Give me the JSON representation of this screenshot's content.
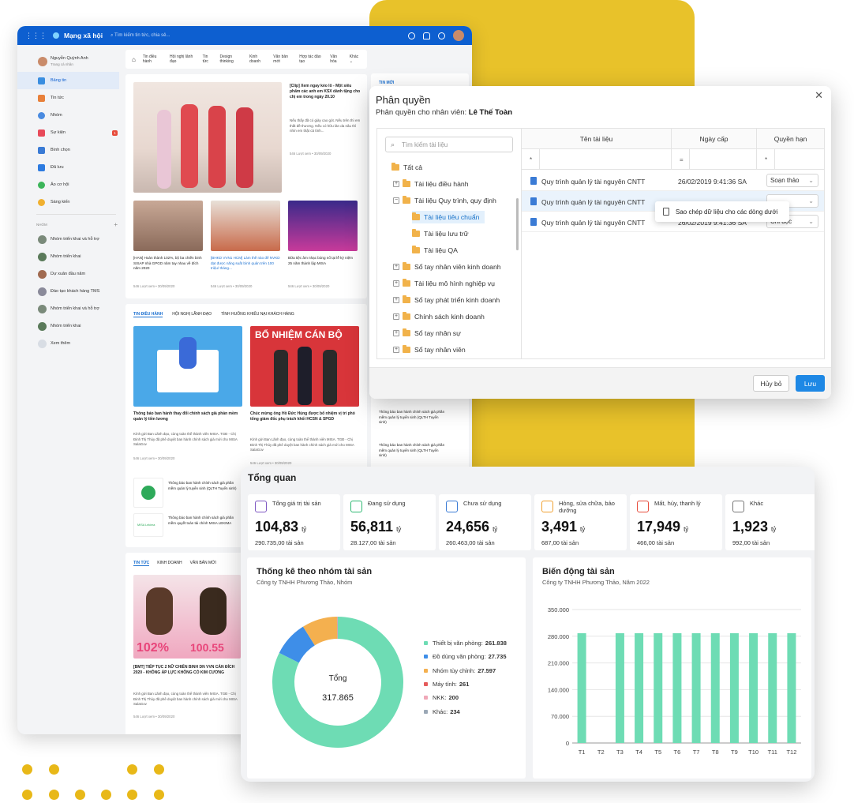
{
  "social": {
    "app_name": "Mạng xã hội",
    "search_placeholder": "Tìm kiếm tin tức, chia sẻ...",
    "user_name": "Nguyễn Quỳnh Anh",
    "user_sub": "Trang cá nhân",
    "menu": [
      "Bảng tin",
      "Tin tức",
      "Nhóm",
      "Sự kiện",
      "Bình chọn",
      "Đã lưu",
      "Ảo cơ hội",
      "Sáng kiến"
    ],
    "event_badge": "1",
    "groups_title": "NHÓM",
    "groups": [
      "Nhóm triển khai và hỗ trợ",
      "Nhóm triển khai",
      "Dự xuân đầu năm",
      "Đào tạo khách hàng TMS",
      "Nhóm triển khai và hỗ trợ",
      "Nhóm triển khai"
    ],
    "more": "Xem thêm",
    "tabs": [
      "Tin điều hành",
      "Hội nghị lãnh đạo",
      "Tin tức",
      "Design thinking",
      "Kinh doanh",
      "Văn bản mới",
      "Hợp tác đào tạo",
      "Văn hóa",
      "Khác"
    ],
    "featured_title": "[Clip] Xem ngay kéo lô - Một siêu phẩm các anh em KSX dành tặng cho chị em trong ngày 20.10",
    "featured_desc": "Nếu thấy đã có giày cao gót. Nếu trên thì em thất đề thương. Nếu có hữu làn da nâu thì nhìn em thật cả tình...",
    "featured_meta": "546 Lượt xem  •  30/09/2020",
    "small_posts": [
      {
        "title": "[HAN] Hoàn thành 102%, bộ ba chiến binh SISAP nhà GPGD năm tay nhau về đích năm 2020",
        "meta": "546 Lượt xem  •  30/09/2020"
      },
      {
        "title": "[BHKD VVN1 HCM] Làm thế nào để NVKD đạt được năng suất bình quân trên 100 triệu/ tháng...",
        "meta": "546 Lượt xem  •  30/09/2020"
      },
      {
        "title": "Bữa tiệc âm nhạc bùng nổ tại lễ kỷ niệm 25 năm thành lập MISA",
        "meta": "546 Lượt xem  •  30/09/2020"
      }
    ],
    "right_title": "TIN MỚI",
    "section2_tabs": [
      "TIN ĐIỀU HÀNH",
      "HỘI NGHỊ LÃNH ĐẠO",
      "TÌNH HUỐNG KHIẾU NẠI KHÁCH HÀNG"
    ],
    "board_banner": "BỔ NHIỆM CÁN BỘ",
    "post_a": {
      "title": "Thông báo ban hành thay đổi chính sách giá phần mềm quản lý tiền lương",
      "desc": "Kính gửi Ban Lãnh đạo, cùng toàn thể thành viên MISA. TGĐ - Chị Đinh Thị Thúy đã phê duyệt ban hành chính sách giá mới cho MISA SalaGov",
      "meta": "546 Lượt xem  •  30/09/2020"
    },
    "post_b": {
      "title": "Chúc mừng ông Hồ Đức Hùng được bổ nhiệm vị trí phó tổng giám đốc phụ trách khối HCSN & SPGD",
      "desc": "Kính gửi Ban Lãnh đạo, cùng toàn thể thành viên MISA. TGĐ - Chị Đinh Thị Thúy đã phê duyệt ban hành chính sách giá mới cho MISA SalaGov",
      "meta": "546 Lượt xem  •  30/09/2020"
    },
    "list_posts": [
      "Thông báo ban hành chính sách giá phần mềm quản lý tuyển sinh (QLTH Tuyển sinh)",
      "Thông báo ban hành chính sách giá phần mềm quyết toán tài chính MISA LEKIMA"
    ],
    "right_posts": [
      "Thông báo ban hành chính sách giá phần mềm quản lý tuyển sinh (QLTH Tuyển sinh)",
      "Thông báo ban hành chính sách giá phần mềm quản lý tuyển sinh (QLTH Tuyển sinh)"
    ],
    "logo_word": "MISA Lekima",
    "section3_tabs": [
      "TIN TỨC",
      "KINH DOANH",
      "VĂN BẢN MỚI"
    ],
    "promo_left": "102%",
    "promo_right": "100.55",
    "post_c": {
      "title": "[BMT] TIẾP TỤC 2 NỮ CHIẾN BINH DN VVN CÁN ĐÍCH 2020 - KHÔNG ÁP LỰC KHÔNG CÓ KIM CƯƠNG",
      "desc": "Kính gửi Ban Lãnh đạo, cùng toàn thể thành viên MISA. TGĐ - Chị Đinh Thị Thúy đã phê duyệt ban hành chính sách giá mới cho MISA SalaGov",
      "meta": "546 Lượt xem  •  30/09/2020"
    }
  },
  "dialog": {
    "title": "Phân quyền",
    "subtitle_prefix": "Phân quyền cho nhân viên:",
    "employee": "Lê Thế Toàn",
    "search_placeholder": "Tìm kiếm tài liệu",
    "tree": [
      "Tất cả",
      "Tài liệu điều hành",
      "Tài liệu Quy trình, quy định",
      "Tài liệu tiêu chuẩn",
      "Tài liệu lưu trữ",
      "Tài liệu QA",
      "Sổ tay nhân viên kinh doanh",
      "Tài liệu mô hình nghiệp vụ",
      "Sổ tay phát triển kinh doanh",
      "Chính sách kinh doanh",
      "Sổ tay nhân sự",
      "Sổ tay nhân viên"
    ],
    "columns": [
      "Tên tài liệu",
      "Ngày cấp",
      "Quyền hạn"
    ],
    "filters": [
      "*",
      "=",
      "*"
    ],
    "rows": [
      {
        "name": "Quy trình quản lý tài nguyên CNTT",
        "date": "26/02/2019 9:41:36 SA",
        "perm": "Soạn thảo"
      },
      {
        "name": "Quy trình quản lý tài nguyên CNTT",
        "date": "",
        "perm": ""
      },
      {
        "name": "Quy trình quản lý tài nguyên CNTT",
        "date": "26/02/2019 9:41:36 SA",
        "perm": "Chỉ đọc"
      }
    ],
    "context_menu": "Sao chép dữ liệu cho các dòng dưới",
    "cancel": "Hủy bỏ",
    "save": "Lưu"
  },
  "dashboard": {
    "title": "Tổng quan",
    "kpis": [
      {
        "label": "Tổng giá trị tài sản",
        "value": "104,83",
        "unit": "tỷ",
        "sub": "290.735,00 tài sản",
        "color": "#7e57c2"
      },
      {
        "label": "Đang sử dụng",
        "value": "56,811",
        "unit": "tỷ",
        "sub": "28.127,00 tài sản",
        "color": "#2eb872"
      },
      {
        "label": "Chưa sử dụng",
        "value": "24,656",
        "unit": "tỷ",
        "sub": "260.463,00 tài sản",
        "color": "#3a7bd5"
      },
      {
        "label": "Hỏng, sửa chữa, bảo dưỡng",
        "value": "3,491",
        "unit": "tỷ",
        "sub": "687,00 tài sản",
        "color": "#f0a030"
      },
      {
        "label": "Mất, hủy, thanh lý",
        "value": "17,949",
        "unit": "tỷ",
        "sub": "466,00 tài sản",
        "color": "#e74c3c"
      },
      {
        "label": "Khác",
        "value": "1,923",
        "unit": "tỷ",
        "sub": "992,00 tài sản",
        "color": "#777777"
      }
    ],
    "donut": {
      "title": "Thống kê theo nhóm tài sản",
      "subtitle": "Công ty TNHH Phương Thảo, Nhóm",
      "center_label": "Tổng",
      "center_value": "317.865"
    },
    "bar": {
      "title": "Biến động tài sản",
      "subtitle": "Công ty TNHH Phương Thảo, Năm 2022"
    }
  },
  "chart_data": [
    {
      "type": "pie",
      "title": "Thống kê theo nhóm tài sản",
      "categories": [
        "Thiết bị văn phòng",
        "Đồ dùng văn phòng",
        "Nhóm tùy chỉnh",
        "Máy tính",
        "NKK",
        "Khác"
      ],
      "values": [
        261838,
        27735,
        27597,
        261,
        200,
        234
      ],
      "values_text": [
        "261.838",
        "27.735",
        "27.597",
        "261",
        "200",
        "234"
      ],
      "colors": [
        "#6edcb4",
        "#3e8ee8",
        "#f4b04f",
        "#e55b5b",
        "#f0a8b8",
        "#9ba8b6"
      ]
    },
    {
      "type": "bar",
      "title": "Biến động tài sản",
      "categories": [
        "T1",
        "T2",
        "T3",
        "T4",
        "T5",
        "T6",
        "T7",
        "T8",
        "T9",
        "T10",
        "T11",
        "T12"
      ],
      "values": [
        288000,
        0,
        288000,
        288000,
        288000,
        288000,
        288000,
        288000,
        288000,
        288000,
        288000,
        288000
      ],
      "yticks": [
        "0",
        "70.000",
        "140.000",
        "210.000",
        "280.000",
        "350.000"
      ],
      "ylim": [
        0,
        350000
      ],
      "color": "#6edcb4"
    }
  ]
}
